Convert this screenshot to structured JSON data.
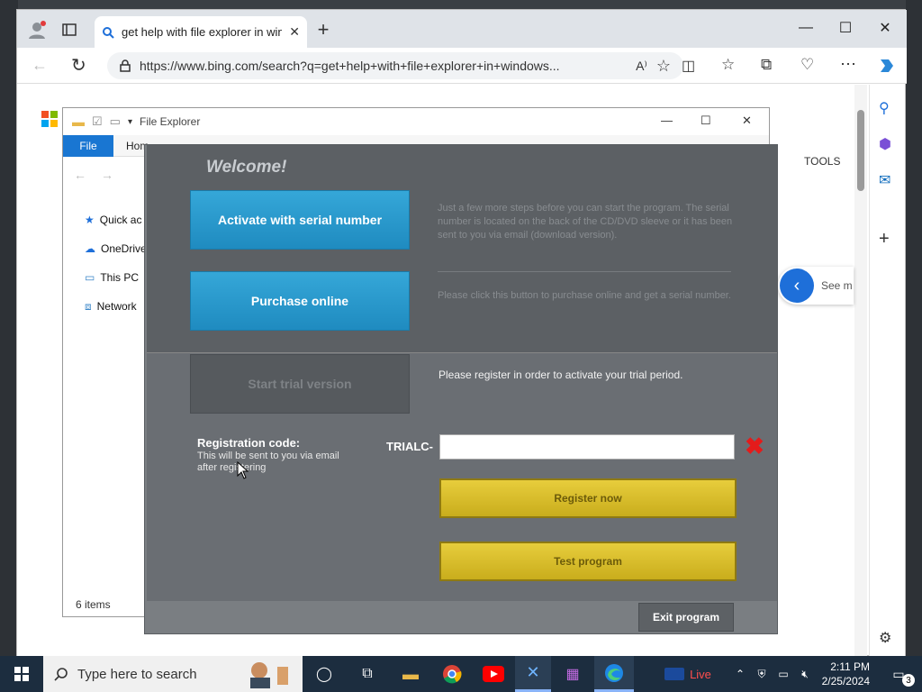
{
  "browser": {
    "tab": {
      "title": "get help with file explorer in windows"
    },
    "address": {
      "url": "https://www.bing.com/search?q=get+help+with+file+explorer+in+windows..."
    }
  },
  "bing": {
    "tools_label": "TOOLS",
    "see_more_label": "See m"
  },
  "file_explorer": {
    "title": "File Explorer",
    "ribbon": {
      "file_tab": "File",
      "home_tab": "Hom"
    },
    "nav": [
      {
        "label": "Quick ac",
        "icon": "star-icon"
      },
      {
        "label": "OneDrive",
        "icon": "cloud-icon"
      },
      {
        "label": "This PC",
        "icon": "computer-icon"
      },
      {
        "label": "Network",
        "icon": "network-icon"
      }
    ],
    "status": "6 items"
  },
  "dialog": {
    "welcome": "Welcome!",
    "activate_button": "Activate with serial number",
    "activate_desc": "Just a few more steps before you can start the program. The serial number is located on the back of the CD/DVD sleeve or it has been sent to you via email (download version).",
    "purchase_button": "Purchase online",
    "purchase_desc": "Please click this button to purchase online and get a serial number.",
    "trial_button": "Start trial version",
    "trial_desc": "Please register in order to activate your trial period.",
    "registration": {
      "title": "Registration code:",
      "subtitle": "This will be sent to you via email after registering",
      "prefix": "TRIALC-",
      "value": ""
    },
    "register_button": "Register now",
    "test_button": "Test program",
    "exit_button": "Exit program",
    "colors": {
      "blue": "#1f8bc0",
      "yellow": "#c9ad1c",
      "clear": "#e41b1b"
    }
  },
  "taskbar": {
    "search_placeholder": "Type here to search",
    "live_label": "Live",
    "time": "2:11 PM",
    "date": "2/25/2024",
    "notification_count": "3"
  }
}
